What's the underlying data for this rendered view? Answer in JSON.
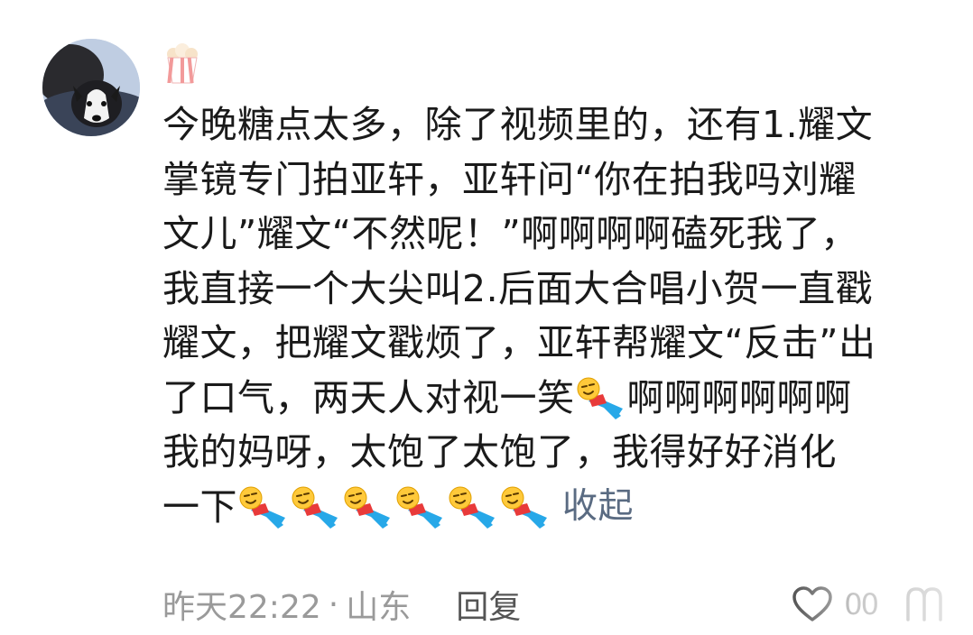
{
  "comment": {
    "lines": [
      "今晚糖点太多，除了视频里的，还有1.耀文",
      "掌镜专门拍亚轩，亚轩问“你在拍我吗刘耀",
      "文儿”耀文“不然呢！”啊啊啊啊磕死我了，",
      "我直接一个大尖叫2.后面大合唱小贺一直戳",
      "耀文，把耀文戳烦了，亚轩帮耀文“反击”出"
    ],
    "line6_before": "了口气，两天人对视一笑",
    "line6_after": "啊啊啊啊啊啊",
    "line7": "我的妈呀，太饱了太饱了，我得好好消化",
    "line8": "一下",
    "collapse_label": "收起",
    "emoji_name": "lying-down-laughing-emoji"
  },
  "footer": {
    "time": "昨天22:22",
    "separator": "·",
    "location": "山东",
    "reply_label": "回复",
    "like_count": "00"
  },
  "icons": {
    "badge": "popcorn-icon",
    "like": "heart-icon",
    "more": "more-icon"
  },
  "colors": {
    "text": "#1a1a1a",
    "meta": "#9a9a9a",
    "collapse": "#5a6b82"
  }
}
